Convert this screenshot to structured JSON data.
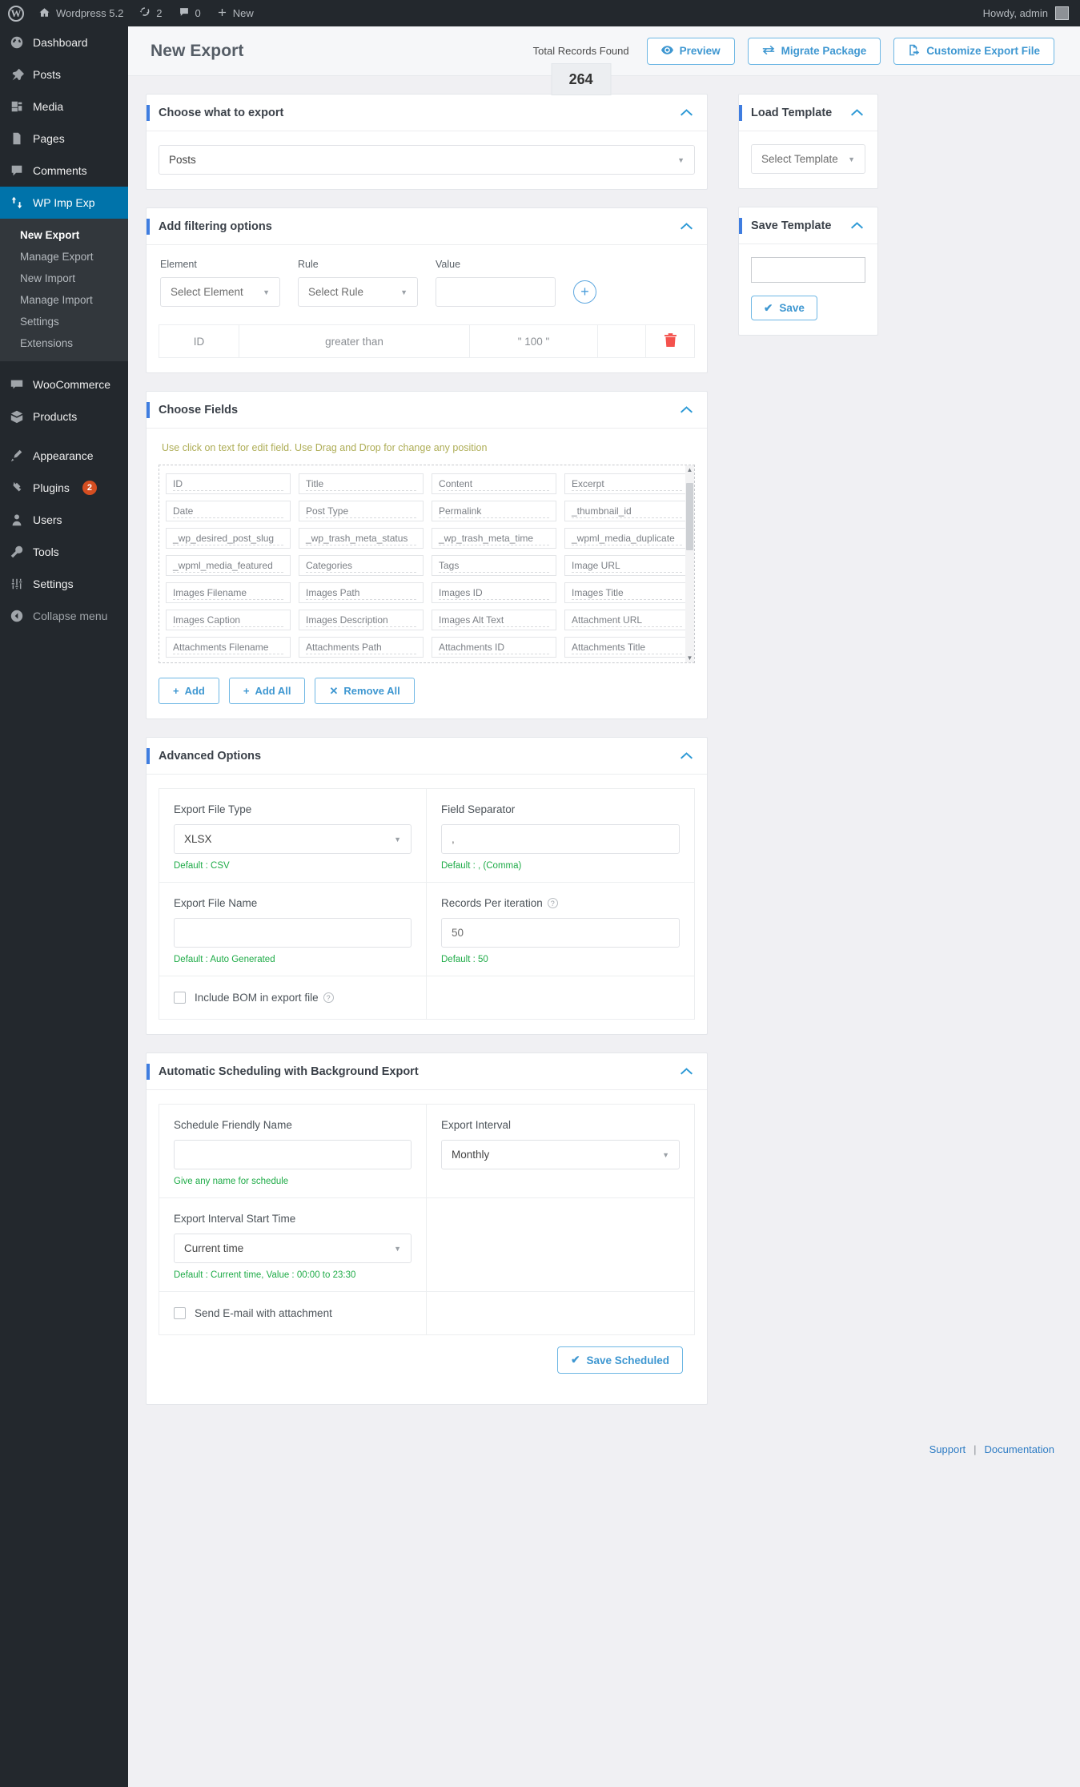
{
  "adminbar": {
    "site_name": "Wordpress 5.2",
    "updates_count": "2",
    "comments_count": "0",
    "new_label": "New",
    "howdy": "Howdy, admin"
  },
  "sidebar": {
    "items": [
      {
        "label": "Dashboard",
        "icon": "dashboard-icon"
      },
      {
        "label": "Posts",
        "icon": "pin-icon"
      },
      {
        "label": "Media",
        "icon": "media-icon"
      },
      {
        "label": "Pages",
        "icon": "pages-icon"
      },
      {
        "label": "Comments",
        "icon": "comments-icon"
      },
      {
        "label": "WP Imp Exp",
        "icon": "import-export-icon",
        "active": true
      }
    ],
    "submenu": [
      {
        "label": "New Export",
        "current": true
      },
      {
        "label": "Manage Export"
      },
      {
        "label": "New Import"
      },
      {
        "label": "Manage Import"
      },
      {
        "label": "Settings"
      },
      {
        "label": "Extensions"
      }
    ],
    "items2": [
      {
        "label": "WooCommerce",
        "icon": "woocommerce-icon"
      },
      {
        "label": "Products",
        "icon": "products-icon"
      }
    ],
    "items3": [
      {
        "label": "Appearance",
        "icon": "appearance-icon"
      },
      {
        "label": "Plugins",
        "icon": "plugins-icon",
        "badge": "2"
      },
      {
        "label": "Users",
        "icon": "users-icon"
      },
      {
        "label": "Tools",
        "icon": "tools-icon"
      },
      {
        "label": "Settings",
        "icon": "settings-icon"
      }
    ],
    "collapse": {
      "label": "Collapse menu",
      "icon": "collapse-icon"
    }
  },
  "header": {
    "title": "New Export",
    "records_label": "Total Records Found",
    "records_value": "264",
    "preview_label": "Preview",
    "migrate_label": "Migrate Package",
    "customize_label": "Customize Export File"
  },
  "choose_export": {
    "title": "Choose what to export",
    "selected": "Posts"
  },
  "filtering": {
    "title": "Add filtering options",
    "labels": {
      "element": "Element",
      "rule": "Rule",
      "value": "Value"
    },
    "element_placeholder": "Select Element",
    "rule_placeholder": "Select Rule",
    "value_value": "",
    "add_icon": "+",
    "rows": [
      {
        "element": "ID",
        "rule": "greater than",
        "value": "\" 100 \""
      }
    ]
  },
  "choose_fields": {
    "title": "Choose Fields",
    "hint": "Use click on text for edit field. Use Drag and Drop for change any position",
    "fields": [
      "ID",
      "Title",
      "Content",
      "Excerpt",
      "Date",
      "Post Type",
      "Permalink",
      "_thumbnail_id",
      "_wp_desired_post_slug",
      "_wp_trash_meta_status",
      "_wp_trash_meta_time",
      "_wpml_media_duplicate",
      "_wpml_media_featured",
      "Categories",
      "Tags",
      "Image URL",
      "Images Filename",
      "Images Path",
      "Images ID",
      "Images Title",
      "Images Caption",
      "Images Description",
      "Images Alt Text",
      "Attachment URL",
      "Attachments Filename",
      "Attachments Path",
      "Attachments ID",
      "Attachments Title"
    ],
    "actions": {
      "add": "Add",
      "add_all": "Add All",
      "remove_all": "Remove All"
    }
  },
  "advanced": {
    "title": "Advanced Options",
    "export_file_type": {
      "label": "Export File Type",
      "value": "XLSX",
      "default": "Default : CSV"
    },
    "field_separator": {
      "label": "Field Separator",
      "value": ",",
      "default": "Default : , (Comma)"
    },
    "export_file_name": {
      "label": "Export File Name",
      "value": "",
      "default": "Default : Auto Generated"
    },
    "records_per_iteration": {
      "label": "Records Per iteration",
      "value": "50",
      "default": "Default : 50"
    },
    "include_bom": {
      "label": "Include BOM in export file",
      "checked": false
    }
  },
  "scheduling": {
    "title": "Automatic Scheduling with Background Export",
    "schedule_name": {
      "label": "Schedule Friendly Name",
      "value": "",
      "default": "Give any name for schedule"
    },
    "export_interval": {
      "label": "Export Interval",
      "value": "Monthly"
    },
    "start_time": {
      "label": "Export Interval Start Time",
      "value": "Current time",
      "default": "Default : Current time, Value : 00:00 to 23:30"
    },
    "send_email": {
      "label": "Send E-mail with attachment",
      "checked": false
    },
    "save_label": "Save Scheduled"
  },
  "load_template": {
    "title": "Load Template",
    "placeholder": "Select Template"
  },
  "save_template": {
    "title": "Save Template",
    "value": "",
    "save_label": "Save"
  },
  "footer": {
    "support": "Support",
    "separator": "|",
    "documentation": "Documentation"
  }
}
